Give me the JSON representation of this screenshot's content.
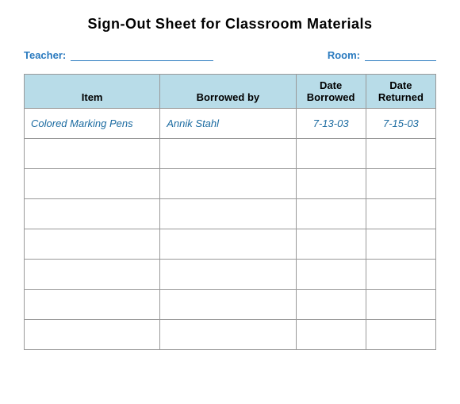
{
  "page": {
    "title": "Sign-Out Sheet for Classroom Materials"
  },
  "form": {
    "teacher_label": "Teacher:",
    "room_label": "Room:"
  },
  "table": {
    "headers": {
      "item": "Item",
      "borrowed_by": "Borrowed by",
      "date_borrowed": "Date Borrowed",
      "date_returned": "Date Returned"
    },
    "rows": [
      {
        "item": "Colored Marking Pens",
        "borrowed_by": "Annik Stahl",
        "date_borrowed": "7-13-03",
        "date_returned": "7-15-03"
      },
      {
        "item": "",
        "borrowed_by": "",
        "date_borrowed": "",
        "date_returned": ""
      },
      {
        "item": "",
        "borrowed_by": "",
        "date_borrowed": "",
        "date_returned": ""
      },
      {
        "item": "",
        "borrowed_by": "",
        "date_borrowed": "",
        "date_returned": ""
      },
      {
        "item": "",
        "borrowed_by": "",
        "date_borrowed": "",
        "date_returned": ""
      },
      {
        "item": "",
        "borrowed_by": "",
        "date_borrowed": "",
        "date_returned": ""
      },
      {
        "item": "",
        "borrowed_by": "",
        "date_borrowed": "",
        "date_returned": ""
      },
      {
        "item": "",
        "borrowed_by": "",
        "date_borrowed": "",
        "date_returned": ""
      }
    ]
  }
}
